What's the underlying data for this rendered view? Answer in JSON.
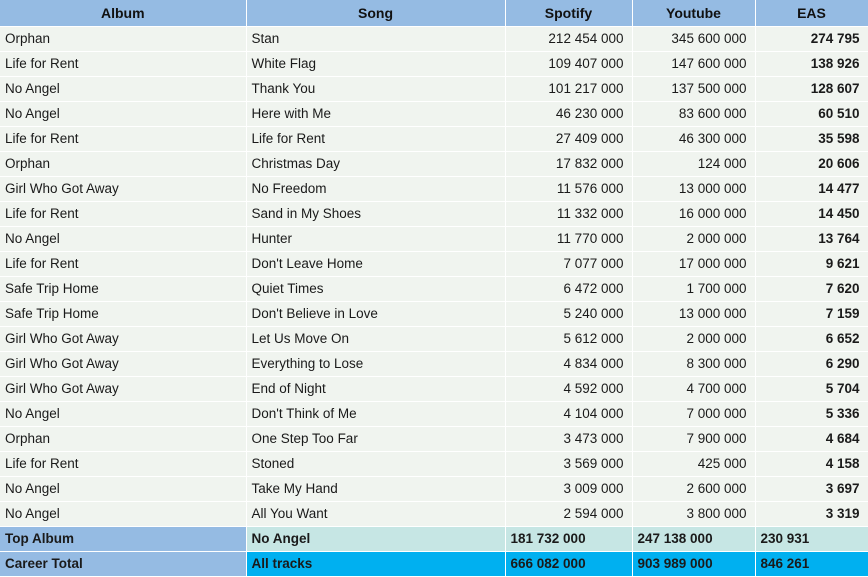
{
  "table": {
    "columns": [
      {
        "key": "album",
        "label": "Album",
        "align": "text"
      },
      {
        "key": "song",
        "label": "Song",
        "align": "text"
      },
      {
        "key": "spotify",
        "label": "Spotify",
        "align": "num"
      },
      {
        "key": "youtube",
        "label": "Youtube",
        "align": "num"
      },
      {
        "key": "eas",
        "label": "EAS",
        "align": "eas"
      }
    ],
    "rows": [
      {
        "album": "Orphan",
        "song": "Stan",
        "spotify": "212 454 000",
        "youtube": "345 600 000",
        "eas": "274 795"
      },
      {
        "album": "Life for Rent",
        "song": "White Flag",
        "spotify": "109 407 000",
        "youtube": "147 600 000",
        "eas": "138 926"
      },
      {
        "album": "No Angel",
        "song": "Thank You",
        "spotify": "101 217 000",
        "youtube": "137 500 000",
        "eas": "128 607"
      },
      {
        "album": "No Angel",
        "song": "Here with Me",
        "spotify": "46 230 000",
        "youtube": "83 600 000",
        "eas": "60 510"
      },
      {
        "album": "Life for Rent",
        "song": "Life for Rent",
        "spotify": "27 409 000",
        "youtube": "46 300 000",
        "eas": "35 598"
      },
      {
        "album": "Orphan",
        "song": "Christmas Day",
        "spotify": "17 832 000",
        "youtube": "124 000",
        "eas": "20 606"
      },
      {
        "album": "Girl Who Got Away",
        "song": "No Freedom",
        "spotify": "11 576 000",
        "youtube": "13 000 000",
        "eas": "14 477"
      },
      {
        "album": "Life for Rent",
        "song": "Sand in My Shoes",
        "spotify": "11 332 000",
        "youtube": "16 000 000",
        "eas": "14 450"
      },
      {
        "album": "No Angel",
        "song": "Hunter",
        "spotify": "11 770 000",
        "youtube": "2 000 000",
        "eas": "13 764"
      },
      {
        "album": "Life for Rent",
        "song": "Don't Leave Home",
        "spotify": "7 077 000",
        "youtube": "17 000 000",
        "eas": "9 621"
      },
      {
        "album": "Safe Trip Home",
        "song": "Quiet Times",
        "spotify": "6 472 000",
        "youtube": "1 700 000",
        "eas": "7 620"
      },
      {
        "album": "Safe Trip Home",
        "song": "Don't Believe in Love",
        "spotify": "5 240 000",
        "youtube": "13 000 000",
        "eas": "7 159"
      },
      {
        "album": "Girl Who Got Away",
        "song": "Let Us Move On",
        "spotify": "5 612 000",
        "youtube": "2 000 000",
        "eas": "6 652"
      },
      {
        "album": "Girl Who Got Away",
        "song": "Everything to Lose",
        "spotify": "4 834 000",
        "youtube": "8 300 000",
        "eas": "6 290"
      },
      {
        "album": "Girl Who Got Away",
        "song": "End of Night",
        "spotify": "4 592 000",
        "youtube": "4 700 000",
        "eas": "5 704"
      },
      {
        "album": "No Angel",
        "song": "Don't Think of Me",
        "spotify": "4 104 000",
        "youtube": "7 000 000",
        "eas": "5 336"
      },
      {
        "album": "Orphan",
        "song": "One Step Too Far",
        "spotify": "3 473 000",
        "youtube": "7 900 000",
        "eas": "4 684"
      },
      {
        "album": "Life for Rent",
        "song": "Stoned",
        "spotify": "3 569 000",
        "youtube": "425 000",
        "eas": "4 158"
      },
      {
        "album": "No Angel",
        "song": "Take My Hand",
        "spotify": "3 009 000",
        "youtube": "2 600 000",
        "eas": "3 697"
      },
      {
        "album": "No Angel",
        "song": "All You Want",
        "spotify": "2 594 000",
        "youtube": "3 800 000",
        "eas": "3 319"
      }
    ],
    "summary": {
      "top_album": {
        "label": "Top Album",
        "value": "No Angel",
        "spotify": "181 732 000",
        "youtube": "247 138 000",
        "eas": "230 931"
      },
      "career_total": {
        "label": "Career Total",
        "value": "All tracks",
        "spotify": "666 082 000",
        "youtube": "903 989 000",
        "eas": "846 261"
      }
    }
  },
  "colors": {
    "header_blue": "#95bbe3",
    "row_background": "#f0f4ef",
    "top_album_cyan": "#c6e6e4",
    "career_total_cyan": "#00b0f0",
    "top_album_eas_text": "#1878c0",
    "career_eas_text": "#ffffff"
  }
}
